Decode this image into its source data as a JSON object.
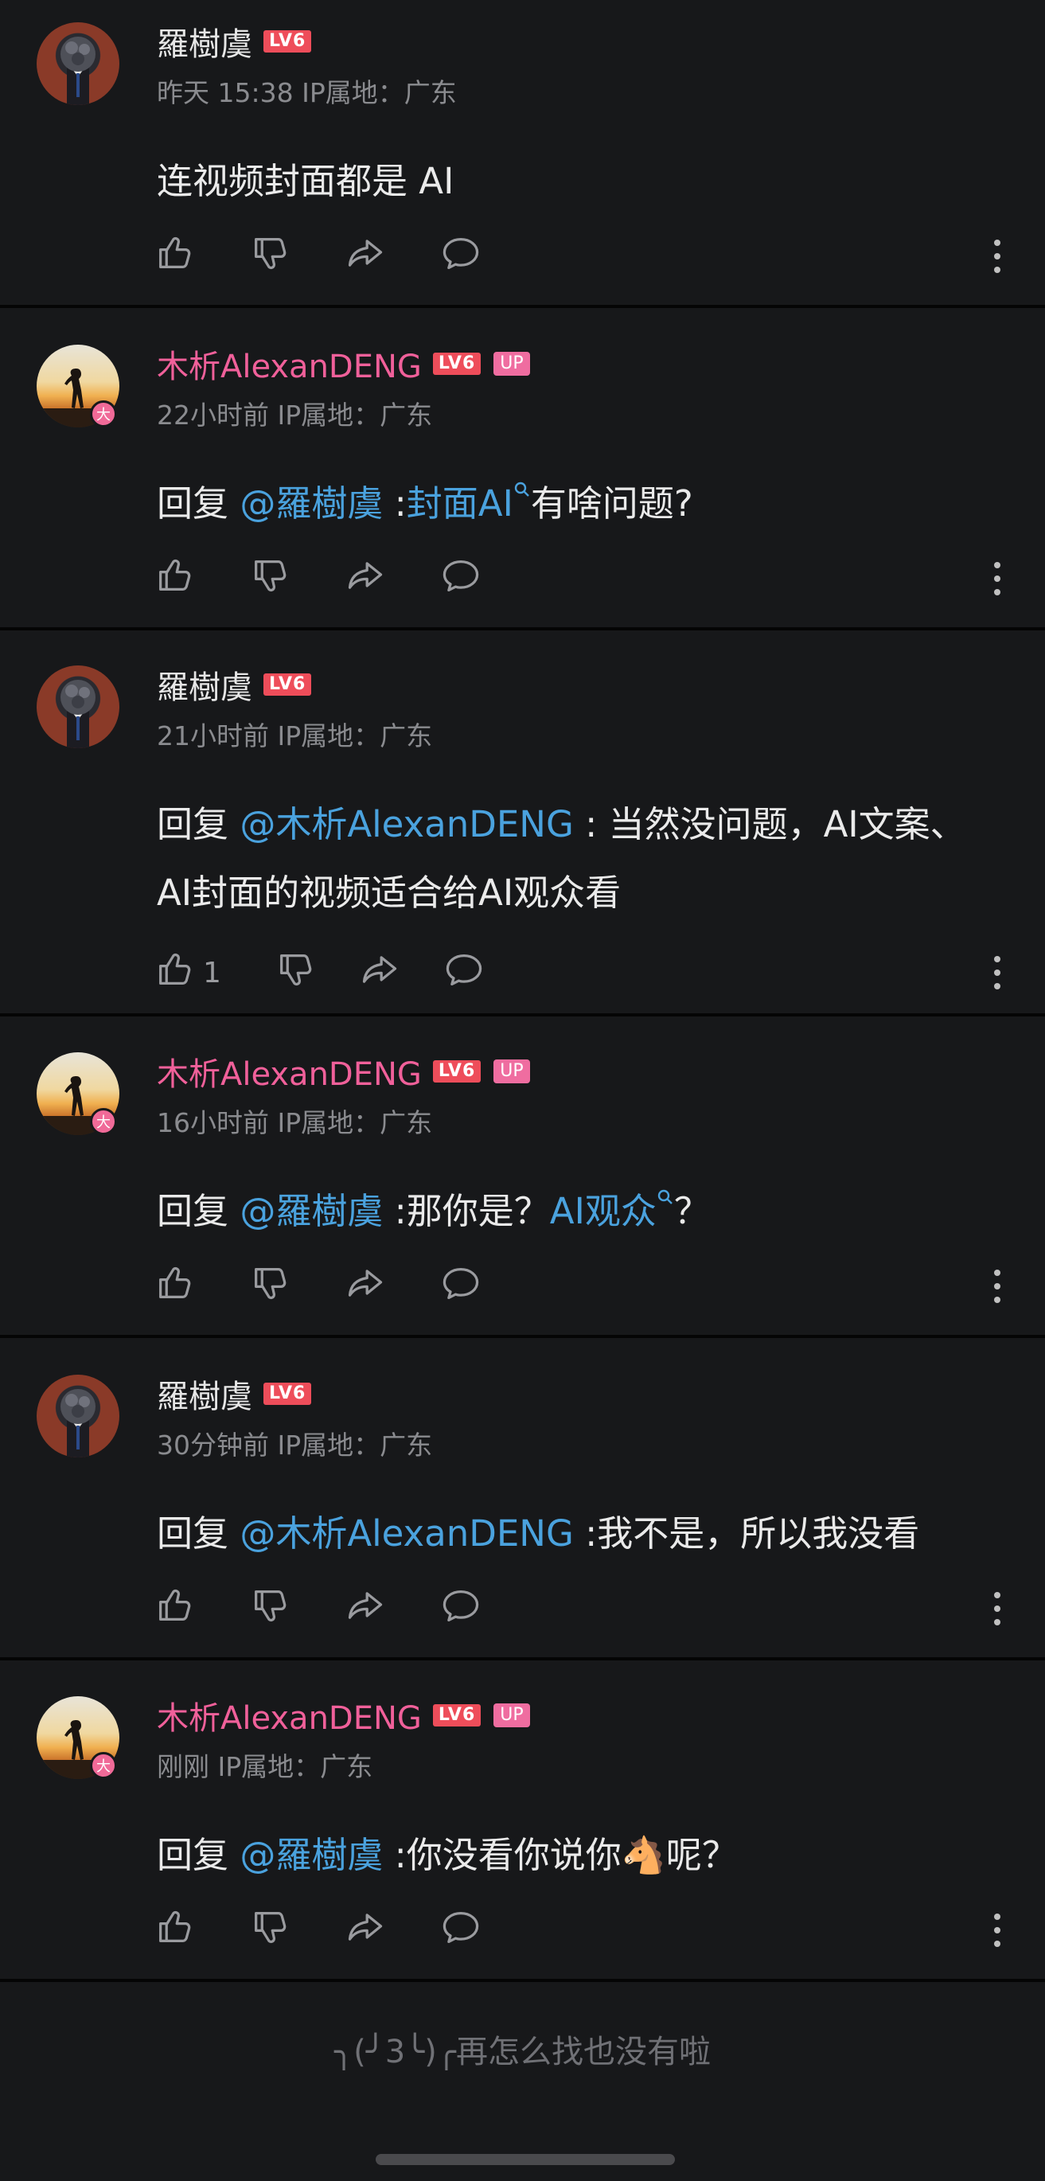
{
  "comments": [
    {
      "user": "羅樹虞",
      "level": "LV6",
      "up": "",
      "time": "昨天 15:38",
      "ip": "IP属地：广东",
      "avatar": "ra",
      "segments": [
        {
          "t": "连视频封面都是 AI",
          "c": ""
        }
      ],
      "likes": ""
    },
    {
      "user": "木析AlexanDENG",
      "level": "LV6",
      "up": "UP",
      "time": "22小时前",
      "ip": "IP属地：广东",
      "avatar": "mu",
      "segments": [
        {
          "t": "回复 ",
          "c": ""
        },
        {
          "t": "@羅樹虞",
          "c": "mention"
        },
        {
          "t": " :",
          "c": ""
        },
        {
          "t": "封面AI",
          "c": "link"
        },
        {
          "t": "有啥问题?",
          "c": ""
        }
      ],
      "likes": ""
    },
    {
      "user": "羅樹虞",
      "level": "LV6",
      "up": "",
      "time": "21小时前",
      "ip": "IP属地：广东",
      "avatar": "ra",
      "segments": [
        {
          "t": "回复 ",
          "c": ""
        },
        {
          "t": "@木析AlexanDENG",
          "c": "mention"
        },
        {
          "t": " : 当然没问题，AI文案、AI封面的视频适合给AI观众看",
          "c": ""
        }
      ],
      "likes": "1"
    },
    {
      "user": "木析AlexanDENG",
      "level": "LV6",
      "up": "UP",
      "time": "16小时前",
      "ip": "IP属地：广东",
      "avatar": "mu",
      "segments": [
        {
          "t": "回复 ",
          "c": ""
        },
        {
          "t": "@羅樹虞",
          "c": "mention"
        },
        {
          "t": " :那你是？",
          "c": ""
        },
        {
          "t": "AI观众",
          "c": "link"
        },
        {
          "t": "？",
          "c": ""
        }
      ],
      "likes": ""
    },
    {
      "user": "羅樹虞",
      "level": "LV6",
      "up": "",
      "time": "30分钟前",
      "ip": "IP属地：广东",
      "avatar": "ra",
      "segments": [
        {
          "t": "回复 ",
          "c": ""
        },
        {
          "t": "@木析AlexanDENG",
          "c": "mention"
        },
        {
          "t": " :我不是，所以我没看",
          "c": ""
        }
      ],
      "likes": ""
    },
    {
      "user": "木析AlexanDENG",
      "level": "LV6",
      "up": "UP",
      "time": "刚刚",
      "ip": "IP属地：广东",
      "avatar": "mu",
      "segments": [
        {
          "t": "回复 ",
          "c": ""
        },
        {
          "t": "@羅樹虞",
          "c": "mention"
        },
        {
          "t": " :你没看你说你🐴呢？",
          "c": ""
        }
      ],
      "likes": ""
    }
  ],
  "big_member_badge": "大",
  "footer_text": "╮(╯3╰)╭再怎么找也没有啦",
  "colors": {
    "background": "#17181a",
    "name_pink": "#f0609a",
    "link_blue": "#4aa2de",
    "level_red": "#ee4d5a",
    "up_pink": "#ef6da0"
  },
  "icons": [
    "like-icon",
    "dislike-icon",
    "share-icon",
    "reply-icon",
    "more-icon",
    "search-icon"
  ]
}
